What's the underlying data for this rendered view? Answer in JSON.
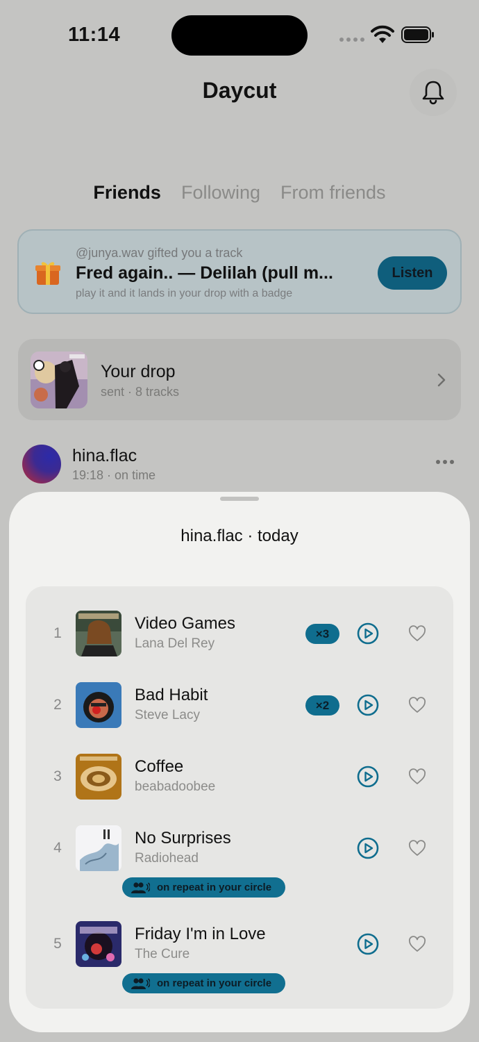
{
  "status_bar": {
    "time": "11:14"
  },
  "header": {
    "title": "Daycut"
  },
  "tabs": [
    {
      "label": "Friends",
      "active": true
    },
    {
      "label": "Following",
      "active": false
    },
    {
      "label": "From friends",
      "active": false
    }
  ],
  "gift": {
    "from": "@junya.wav gifted you a track",
    "track": "Fred again.. — Delilah (pull m...",
    "note": "play it and it lands in your drop with a badge",
    "action_label": "Listen",
    "icon": "gift-icon"
  },
  "your_drop": {
    "title": "Your drop",
    "subtitle": "sent · 8 tracks"
  },
  "friend": {
    "name": "hina.flac",
    "meta": "19:18 · on time"
  },
  "sheet": {
    "title": "hina.flac · today",
    "tracks": [
      {
        "rank": "1",
        "title": "Video Games",
        "artist": "Lana Del Rey",
        "count": "×3"
      },
      {
        "rank": "2",
        "title": "Bad Habit",
        "artist": "Steve Lacy",
        "count": "×2"
      },
      {
        "rank": "3",
        "title": "Coffee",
        "artist": "beabadoobee",
        "count": ""
      },
      {
        "rank": "4",
        "title": "No Surprises",
        "artist": "Radiohead",
        "count": "",
        "badge": "on repeat in your circle"
      },
      {
        "rank": "5",
        "title": "Friday I'm in Love",
        "artist": "The Cure",
        "count": "",
        "badge": "on repeat in your circle"
      }
    ]
  },
  "colors": {
    "accent": "#0f6d8e",
    "background": "#c4c4c2",
    "sheet": "#f2f2f0"
  }
}
